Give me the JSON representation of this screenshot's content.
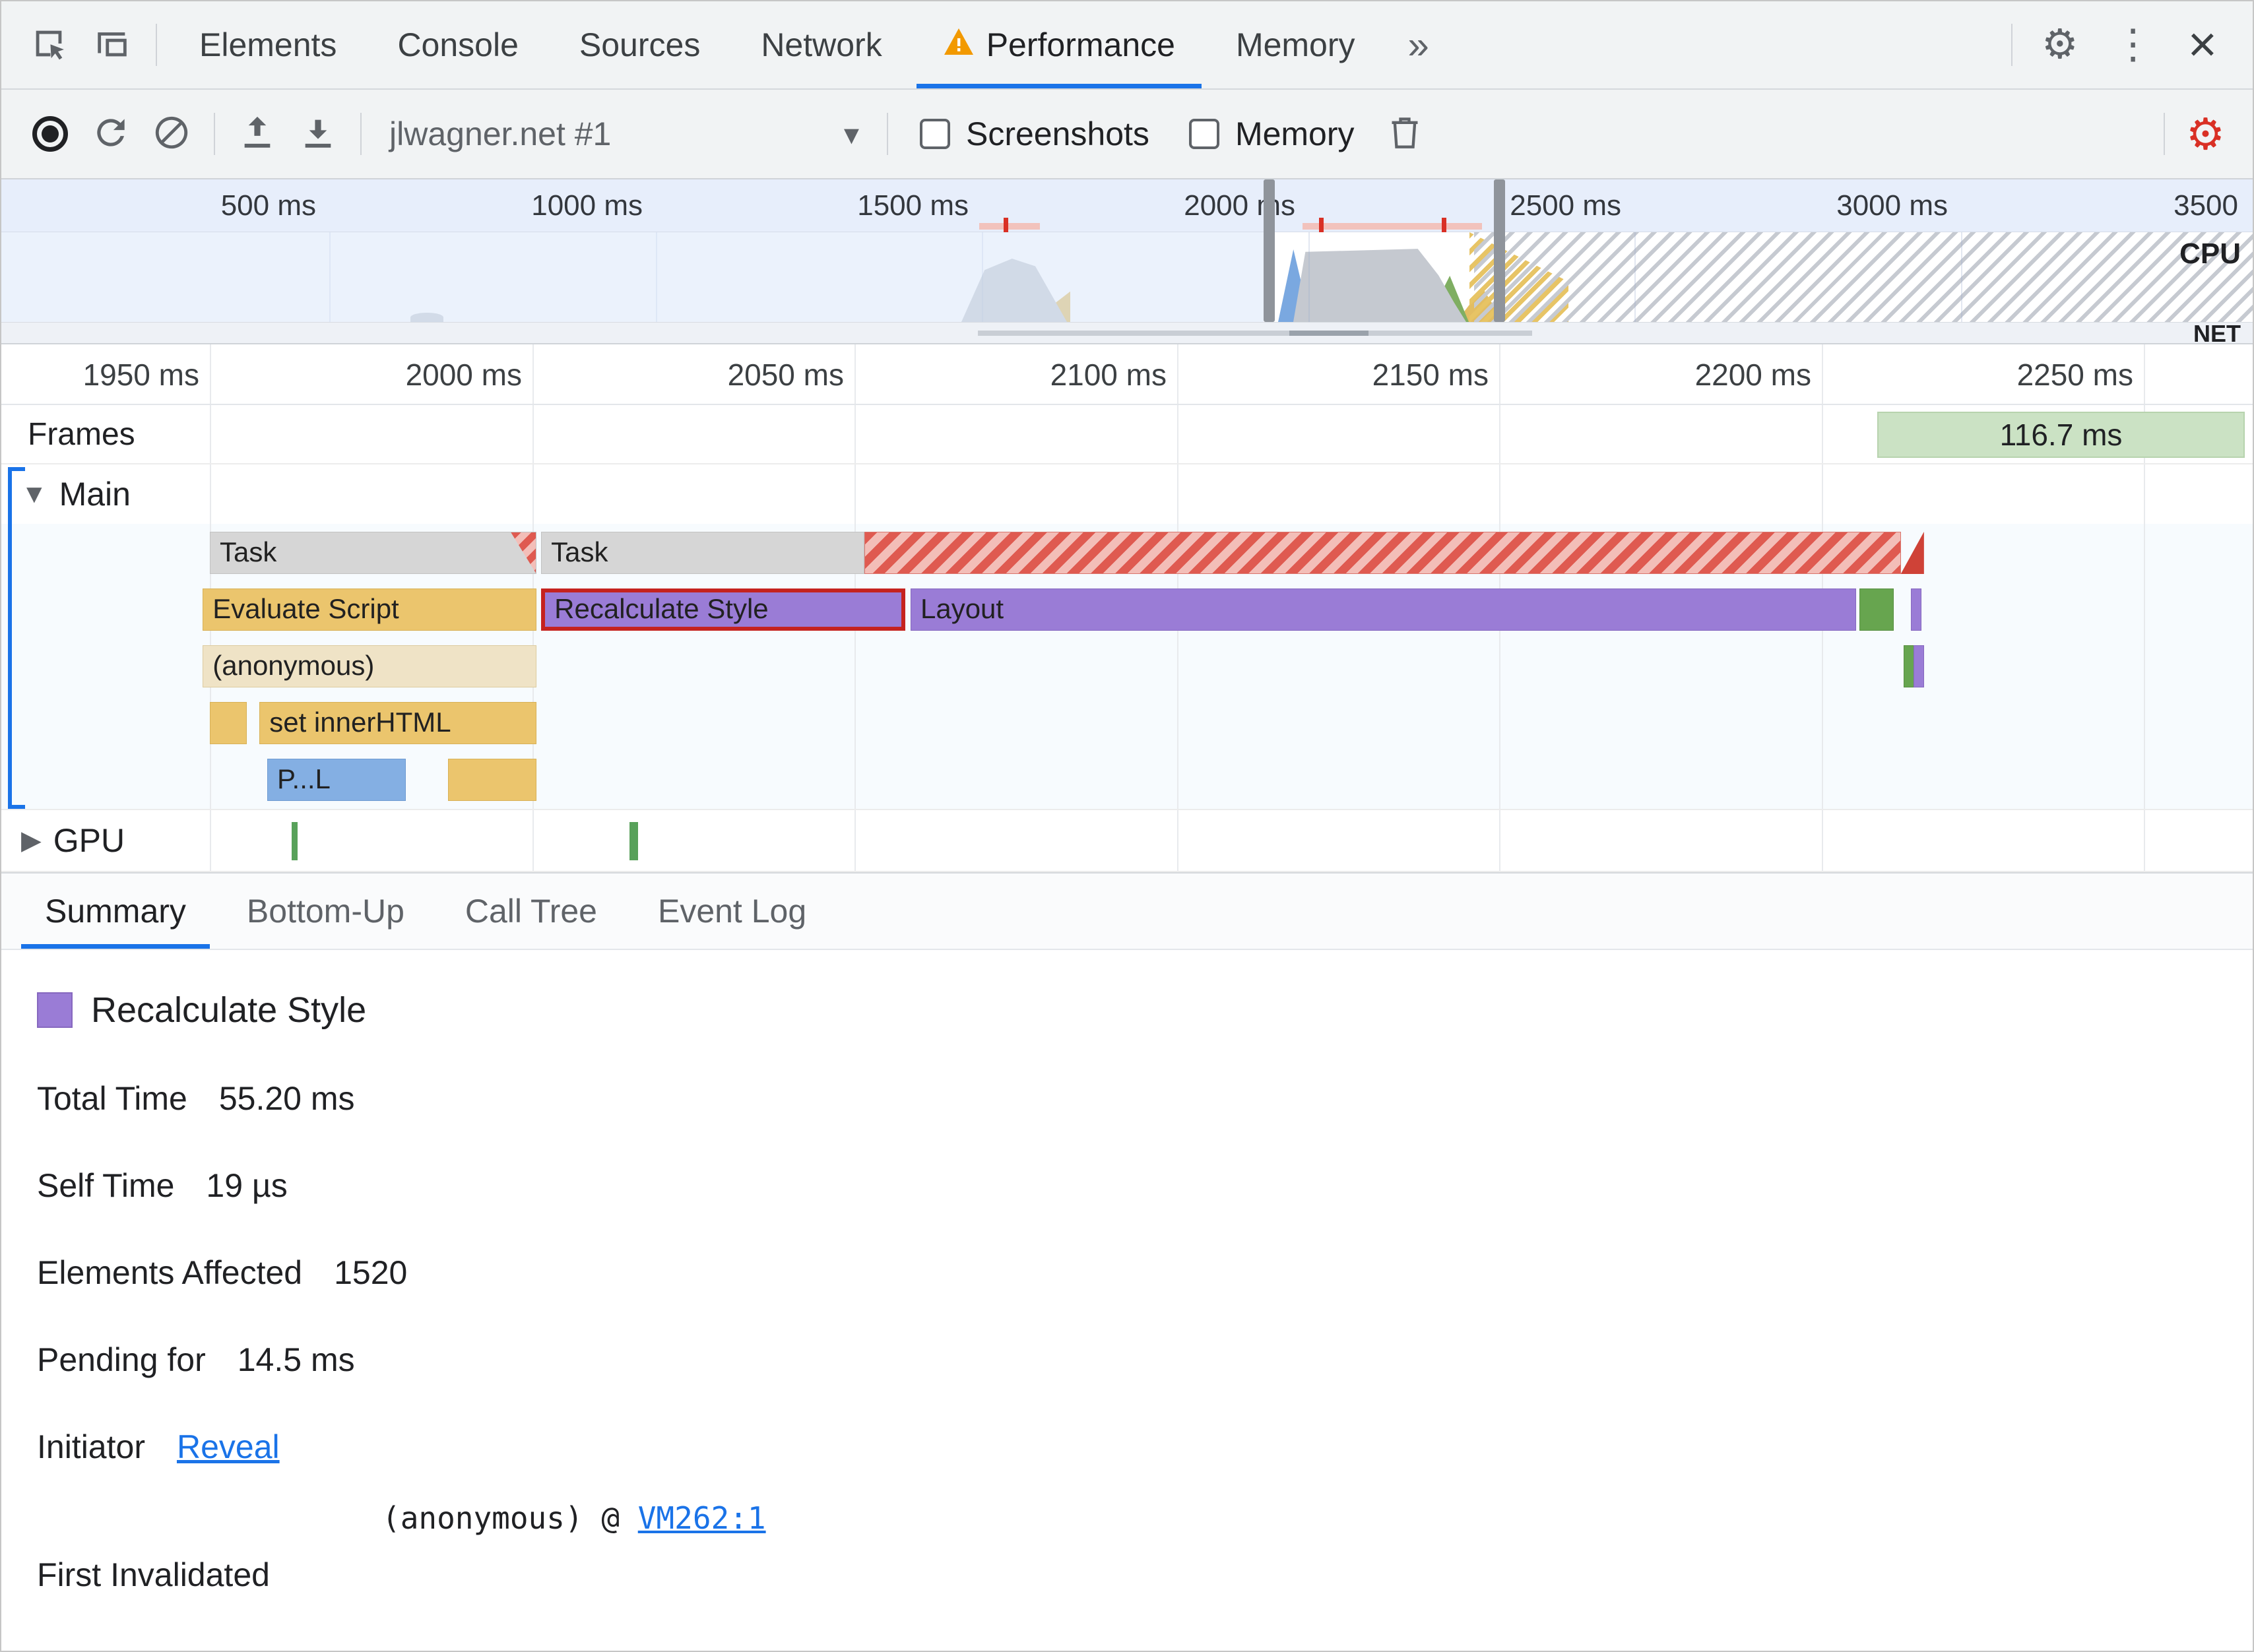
{
  "colors": {
    "accent": "#1a73e8",
    "warning": "#f29900",
    "danger": "#d93025",
    "task_gray": "#d6d6d6",
    "scripting_yellow": "#ebc56d",
    "rendering_purple": "#9a7cd6",
    "painting_green": "#67a54f",
    "parsing_blue": "#84afe3",
    "frame_green": "#cbe2c4"
  },
  "glyphs": {
    "more_tabs": "»",
    "overflow": "⋮",
    "close": "×",
    "settings": "⚙",
    "dropdown": "▾",
    "expanded": "▼",
    "collapsed": "▶"
  },
  "devtools": {
    "tabs": [
      {
        "label": "Elements"
      },
      {
        "label": "Console"
      },
      {
        "label": "Sources"
      },
      {
        "label": "Network"
      },
      {
        "label": "Performance",
        "active": true,
        "warning": true
      },
      {
        "label": "Memory"
      }
    ]
  },
  "toolbar": {
    "session_label": "jlwagner.net #1",
    "screenshots_label": "Screenshots",
    "memory_label": "Memory"
  },
  "overview": {
    "ticks": [
      "500 ms",
      "1000 ms",
      "1500 ms",
      "2000 ms",
      "2500 ms",
      "3000 ms",
      "3500"
    ],
    "cpu_label": "CPU",
    "net_label": "NET"
  },
  "detail_ruler": {
    "ticks": [
      "1950 ms",
      "2000 ms",
      "2050 ms",
      "2100 ms",
      "2150 ms",
      "2200 ms",
      "2250 ms"
    ]
  },
  "frames": {
    "label": "Frames",
    "frame_duration": "116.7 ms"
  },
  "main_track": {
    "label": "Main",
    "bars": [
      {
        "row": 0,
        "start": 1950.0,
        "end": 2000.7,
        "label": "Task",
        "type": "task",
        "flag": true
      },
      {
        "row": 0,
        "start": 2001.4,
        "end": 2051.5,
        "label": "Task",
        "type": "task"
      },
      {
        "row": 0,
        "start": 2051.5,
        "end": 2212.3,
        "type": "longtask"
      },
      {
        "row": 0,
        "start": 2212.3,
        "end": 2215.9,
        "type": "longtask-end"
      },
      {
        "row": 1,
        "start": 1948.9,
        "end": 2000.7,
        "label": "Evaluate Script",
        "type": "script"
      },
      {
        "row": 1,
        "start": 2001.4,
        "end": 2057.9,
        "label": "Recalculate Style",
        "type": "render",
        "highlight": true
      },
      {
        "row": 1,
        "start": 2058.7,
        "end": 2205.4,
        "label": "Layout",
        "type": "render"
      },
      {
        "row": 1,
        "start": 2205.9,
        "end": 2211.2,
        "type": "paint"
      },
      {
        "row": 1,
        "start": 2213.9,
        "end": 2215.1,
        "type": "render"
      },
      {
        "row": 2,
        "start": 1948.9,
        "end": 2000.7,
        "label": "(anonymous)",
        "type": "func"
      },
      {
        "row": 2,
        "start": 2212.7,
        "end": 2213.7,
        "type": "paint"
      },
      {
        "row": 2,
        "start": 2214.3,
        "end": 2215.3,
        "type": "render"
      },
      {
        "row": 3,
        "start": 1950.0,
        "end": 1955.7,
        "type": "script"
      },
      {
        "row": 3,
        "start": 1957.7,
        "end": 2000.7,
        "label": "set innerHTML",
        "type": "script"
      },
      {
        "row": 4,
        "start": 1958.9,
        "end": 1980.4,
        "label": "P...L",
        "type": "parse"
      },
      {
        "row": 4,
        "start": 1986.9,
        "end": 2000.7,
        "type": "script"
      }
    ]
  },
  "gpu_track": {
    "label": "GPU"
  },
  "bottom_tabs": [
    {
      "label": "Summary",
      "active": true
    },
    {
      "label": "Bottom-Up"
    },
    {
      "label": "Call Tree"
    },
    {
      "label": "Event Log"
    }
  ],
  "summary": {
    "selected_event": "Recalculate Style",
    "rows": [
      {
        "label": "Total Time",
        "value": "55.20 ms"
      },
      {
        "label": "Self Time",
        "value": "19 µs"
      },
      {
        "label": "Elements Affected",
        "value": "1520"
      },
      {
        "label": "Pending for",
        "value": "14.5 ms"
      }
    ],
    "initiator_label": "Initiator",
    "initiator_link": "Reveal",
    "first_invalidated_label": "First Invalidated",
    "first_invalidated_value": "(anonymous) @ ",
    "first_invalidated_link": "VM262:1"
  }
}
